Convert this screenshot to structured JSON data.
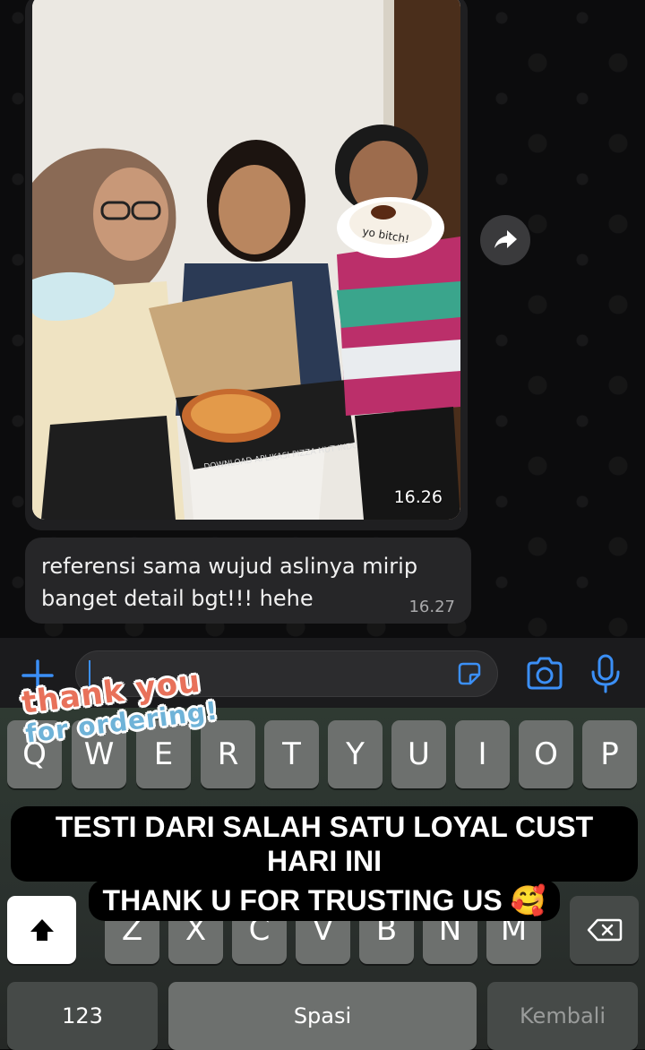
{
  "chat": {
    "photo_message": {
      "time": "16.26",
      "box_text": "DOWNLOAD APLIKASI PIZZA HUT INDONESIA DI",
      "cake_text": "yo bitch!"
    },
    "text_message": {
      "text": "referensi sama wujud aslinya mirip banget detail bgt!!! hehe",
      "time": "16.27"
    }
  },
  "input_bar": {
    "plus_icon": "plus-icon",
    "sticker_icon": "sticker-icon",
    "camera_icon": "camera-icon",
    "mic_icon": "microphone-icon",
    "accent": "#3b8ff6"
  },
  "keyboard": {
    "row1": [
      "Q",
      "W",
      "E",
      "R",
      "T",
      "Y",
      "U",
      "I",
      "O",
      "P"
    ],
    "row3": [
      "Z",
      "X",
      "C",
      "V",
      "B",
      "N",
      "M"
    ],
    "num_label": "123",
    "space_label": "Spasi",
    "return_label": "Kembali"
  },
  "overlay": {
    "sticker_line1": "thank you",
    "sticker_line2": "for ordering!",
    "caption_line1": "TESTI DARI SALAH SATU LOYAL CUST HARI INI",
    "caption_line2": "THANK U FOR TRUSTING US 🥰"
  }
}
